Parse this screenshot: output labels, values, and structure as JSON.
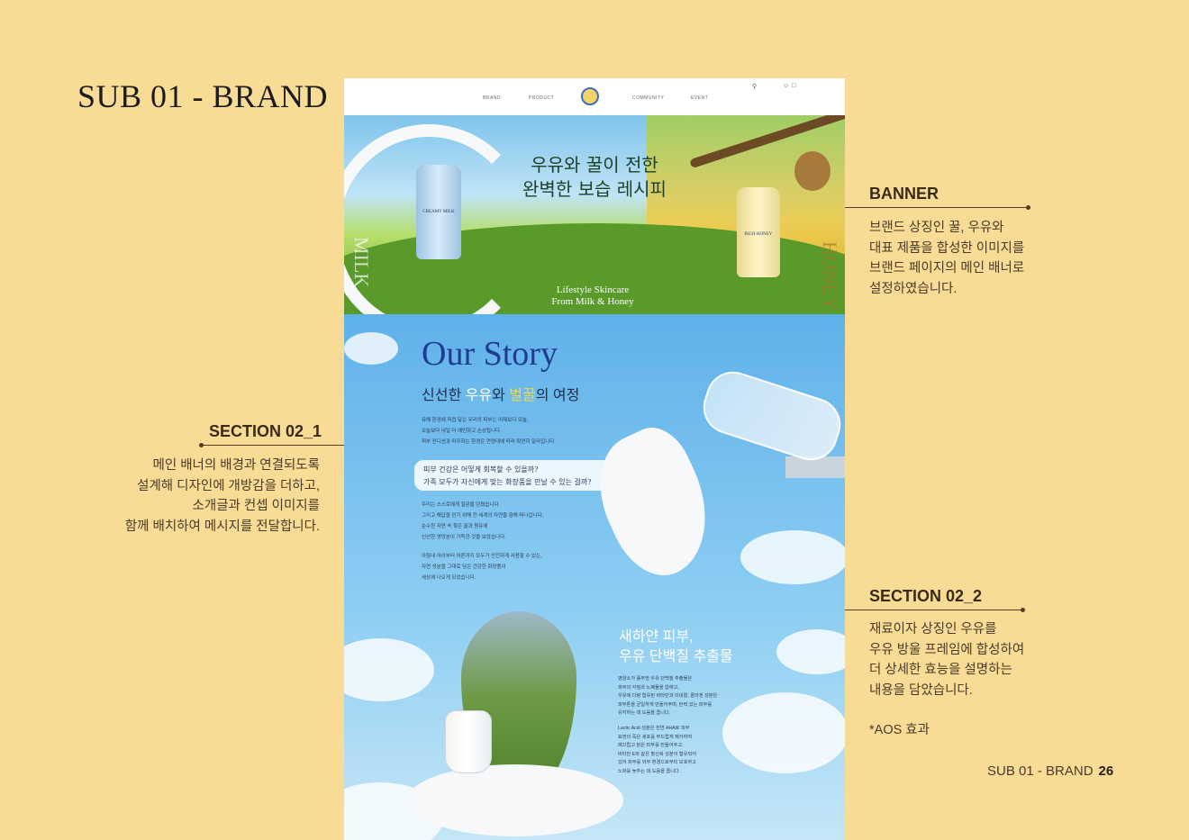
{
  "page": {
    "title": "SUB 01 - BRAND",
    "footer_section": "SUB 01 - BRAND",
    "footer_page": "26"
  },
  "annotations": {
    "banner": {
      "title": "BANNER",
      "lines": [
        "브랜드 상징인 꿀, 우유와",
        "대표 제품을 합성한 이미지를",
        "브랜드 페이지의 메인 배너로",
        "설정하였습니다."
      ]
    },
    "section_02_1": {
      "title": "SECTION 02_1",
      "lines": [
        "메인 배너의 배경과 연결되도록",
        "설계해 디자인에 개방감을 더하고,",
        "소개글과 컨셉 이미지를",
        "함께 배치하여 메시지를 전달합니다."
      ]
    },
    "section_02_2": {
      "title": "SECTION 02_2",
      "lines": [
        "재료이자 상징인 우유를",
        "우유 방울 프레임에 합성하여",
        "더 상세한 효능을 설명하는",
        "내용을 담았습니다."
      ],
      "note": "*AOS 효과"
    }
  },
  "mockup": {
    "nav": {
      "items": [
        "BRAND",
        "PRODUCT",
        "COMMUNITY",
        "EVENT"
      ]
    },
    "banner": {
      "title_line1": "우유와 꿀이 전한",
      "title_line2": "완벽한 보습 레시피",
      "tagline_line1": "Lifestyle Skincare",
      "tagline_line2": "From Milk & Honey",
      "vertical_left": "MILK",
      "vertical_right": "HONEY",
      "product_left": "CREAMY MILK",
      "product_right": "RICH HONEY"
    },
    "story": {
      "title": "Our Story",
      "subtitle_pre": "신선한 ",
      "subtitle_milk": "우유",
      "subtitle_mid": "와 ",
      "subtitle_honey": "벌꿀",
      "subtitle_post": "의 여정",
      "para1": [
        "유해 환경에 직접 닿는 우리의 피부는 어제보다 오늘,",
        "오늘보다 내일 더 예민하고 손상됩니다.",
        "피부 컨디션과 마주하는 환경은 연령대에 따라 확연히 달라집니다."
      ],
      "quote_line1": "피부 건강은 어떻게 회복할 수 있을까?",
      "quote_line2": "가족 모두가 자신에게 맞는 화장품을 만날 수 있는 걸까?",
      "para2": [
        "우리는 스스로에게 질문을 던졌습니다.",
        "그리고 해답을 얻기 위해 전 세계의 자연을 향해 떠나갑니다.",
        "순수한 자연 속 찾은 꿀과 원유에",
        "신선한 영양분이 가득한 것을 보았습니다."
      ],
      "para3": [
        "아침내 아이부터 어른까지 모두가 안전하게 사용할 수 있는,",
        "자연 성분을 그대로 담은 건강한 화장품이",
        "세상에 나오게 되었습니다."
      ]
    },
    "feature": {
      "title_line1": "새하얀 피부,",
      "title_line2": "우유 단백질 추출물",
      "text1": [
        "영양소가 풍부한 우유 단백질 추출물은",
        "피부의 각질과 노폐물을 없애고,",
        "우유에 다량 함유된 비타민과 미네랄, 콜라겐 성분은",
        "피부톤을 균일하게 만들어주며, 탄력 있는 피부를",
        "유지하는 데 도움을 줍니다."
      ],
      "text2": [
        "Lactic Acid 성분은 천연 AHA로 피부",
        "표면의 죽은 세포를 부드럽게 제거하여",
        "매끄럽고 맑은 피부를 만들어주고,",
        "비타민 E와 같은 항산화 성분이 함유되어",
        "있어 피부를 외부 환경으로부터 보호하고",
        "노화를 늦추는 데 도움을 줍니다."
      ]
    }
  }
}
